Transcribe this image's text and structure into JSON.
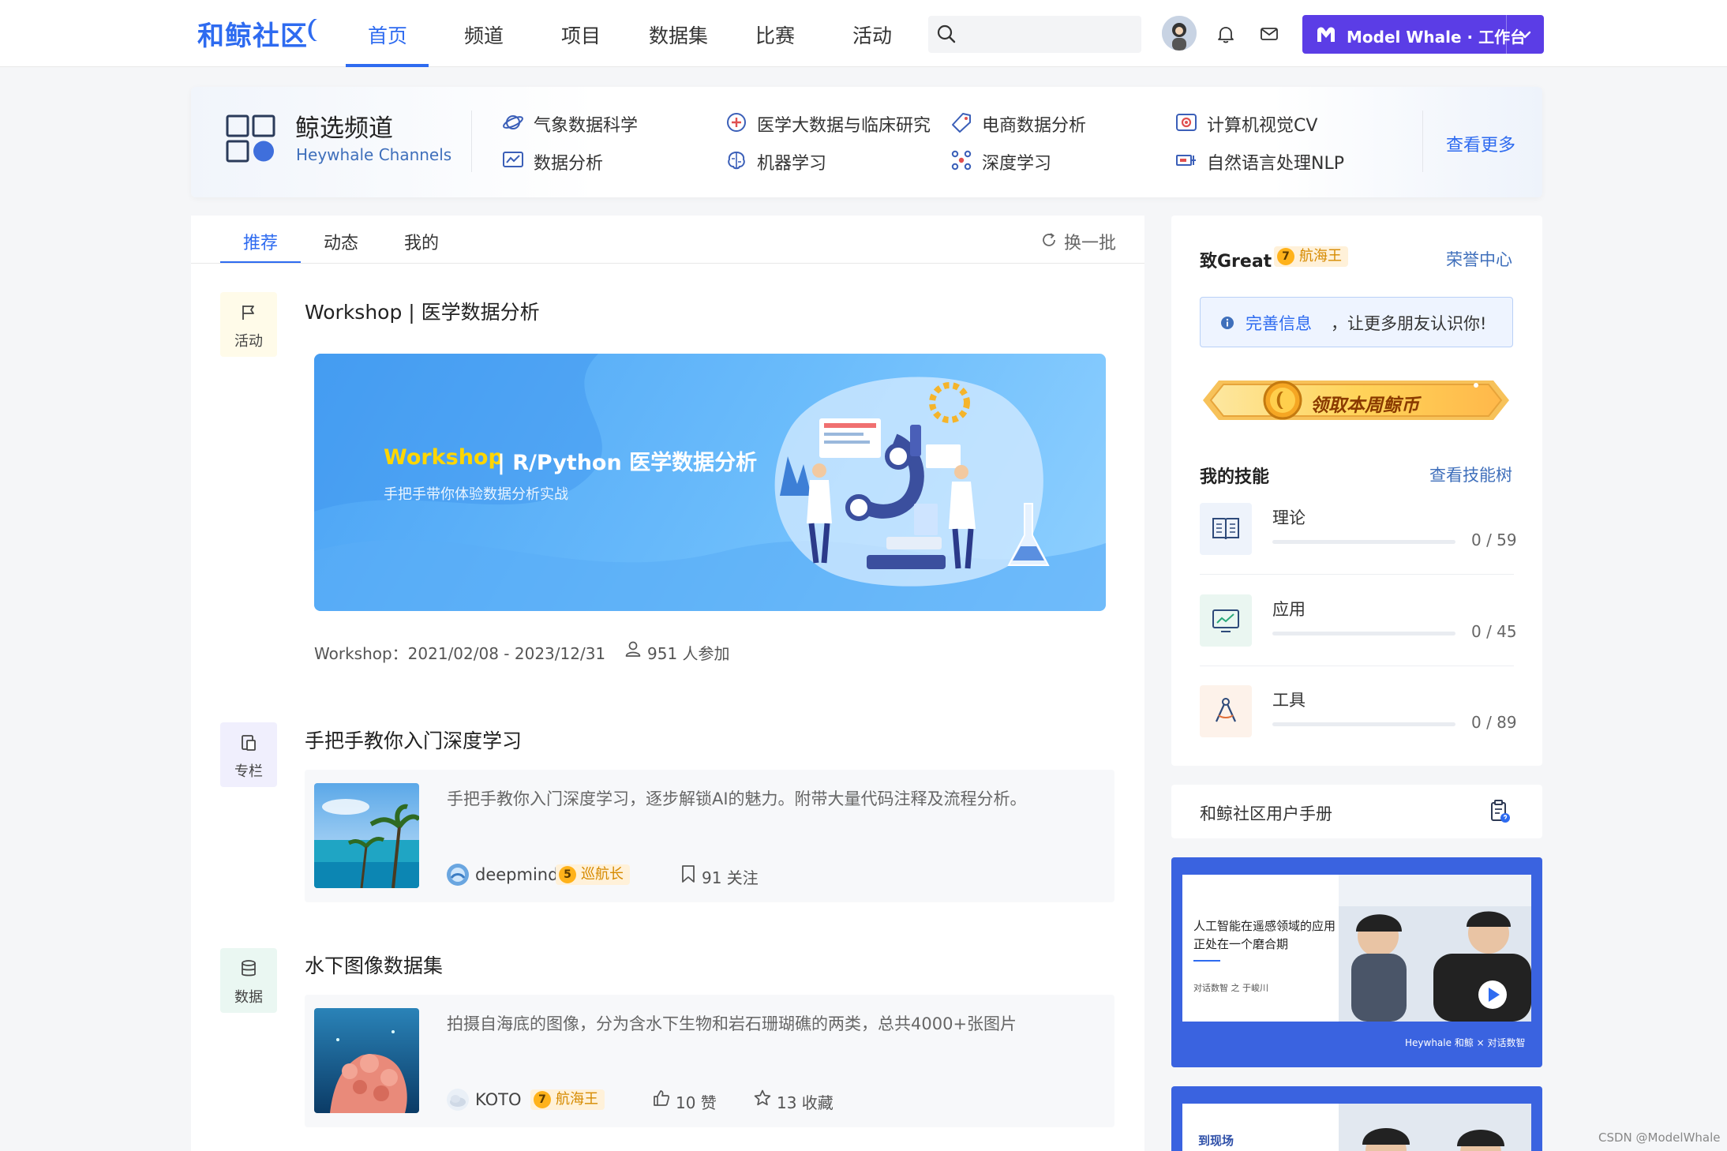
{
  "nav": {
    "logo": "和鲸社区",
    "items": [
      "首页",
      "频道",
      "项目",
      "数据集",
      "比赛",
      "活动"
    ],
    "workbench_brand": "Model Whale",
    "workbench_sep": "·",
    "workbench_label": "工作台"
  },
  "channels": {
    "title": "鲸选频道",
    "subtitle": "Heywhale Channels",
    "items": [
      {
        "label": "气象数据科学",
        "icon": "planet-icon"
      },
      {
        "label": "医学大数据与临床研究",
        "icon": "medical-cross-icon"
      },
      {
        "label": "电商数据分析",
        "icon": "tag-icon"
      },
      {
        "label": "计算机视觉CV",
        "icon": "eye-icon"
      },
      {
        "label": "数据分析",
        "icon": "chart-monitor-icon"
      },
      {
        "label": "机器学习",
        "icon": "brain-icon"
      },
      {
        "label": "深度学习",
        "icon": "network-icon"
      },
      {
        "label": "自然语言处理NLP",
        "icon": "nlp-icon"
      }
    ],
    "more": "查看更多"
  },
  "feed": {
    "tabs": [
      "推荐",
      "动态",
      "我的"
    ],
    "refresh": "换一批",
    "posts": [
      {
        "type": "活动",
        "title": "Workshop | 医学数据分析",
        "banner_title_a": "Workshop",
        "banner_title_b": "| R/Python 医学数据分析",
        "banner_sub": "手把手带你体验数据分析实战",
        "date": "Workshop：2021/02/08 - 2023/12/31",
        "participants": "951 人参加"
      },
      {
        "type": "专栏",
        "title": "手把手教你入门深度学习",
        "desc": "手把手教你入门深度学习，逐步解锁AI的魅力。附带大量代码注释及流程分析。",
        "author": "deepmind",
        "level_num": "5",
        "level_name": "巡航长",
        "stat": "91 关注"
      },
      {
        "type": "数据",
        "title": "水下图像数据集",
        "desc": "拍摄自海底的图像，分为含水下生物和岩石珊瑚礁的两类，总共4000+张图片",
        "author": "KOTO",
        "level_num": "7",
        "level_name": "航海王",
        "likes": "10 赞",
        "favs": "13 收藏"
      }
    ]
  },
  "sidebar": {
    "username": "致Great",
    "level_num": "7",
    "level_name": "航海王",
    "honor_link": "荣誉中心",
    "info_link": "完善信息",
    "info_text": "，让更多朋友认识你!",
    "coin_label": "领取本周鲸币",
    "skills_title": "我的技能",
    "skills_link": "查看技能树",
    "skills": [
      {
        "name": "理论",
        "value": "0 / 59",
        "progress": 0
      },
      {
        "name": "应用",
        "value": "0 / 45",
        "progress": 0
      },
      {
        "name": "工具",
        "value": "0 / 89",
        "progress": 0
      }
    ],
    "manual": "和鲸社区用户手册",
    "video1": {
      "text_line1": "人工智能在遥感领域的应用",
      "text_line2": "正处在一个磨合期",
      "credit": "对话数智 之 于峻川",
      "footer": "Heywhale 和鲸 × 对话数智"
    },
    "video2": {
      "text": "到现场"
    }
  },
  "watermark": "CSDN @ModelWhale",
  "colors": {
    "accent": "#2e6bf0",
    "workbench": "#5b3de6",
    "level_badge": "#ffb21a"
  }
}
